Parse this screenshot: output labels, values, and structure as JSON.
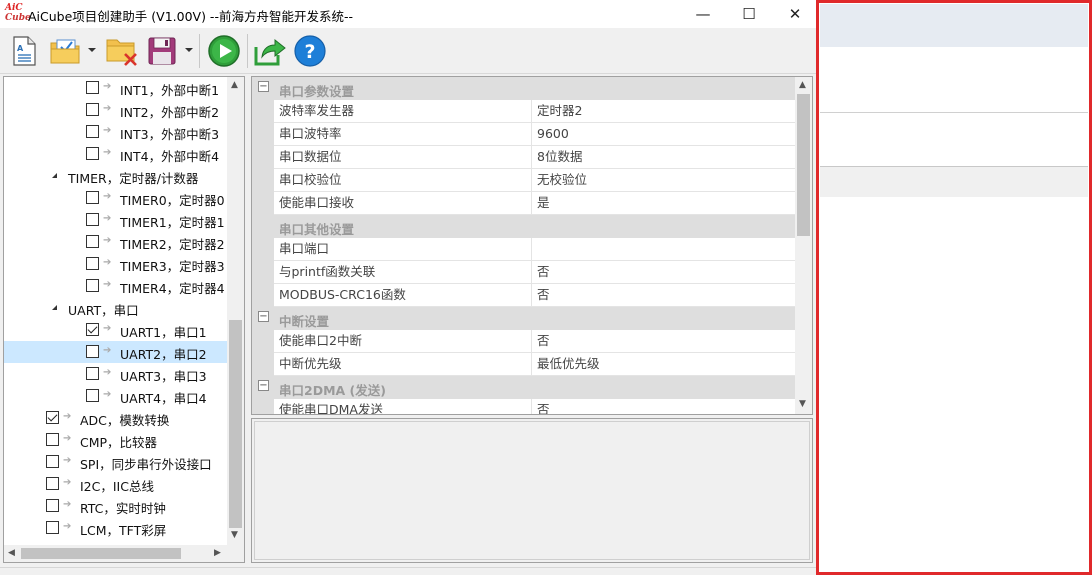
{
  "window": {
    "logo_line1": "AiC",
    "logo_line2": "Cube",
    "title": "AiCube项目创建助手 (V1.00V) --前海方舟智能开发系统--",
    "minimize": "—",
    "maximize": "☐",
    "close": "✕"
  },
  "toolbar": {
    "buttons": [
      {
        "name": "new-project",
        "icon": "new-document-icon"
      },
      {
        "name": "open-project",
        "icon": "open-folder-check-icon"
      },
      {
        "name": "close-project",
        "icon": "folder-delete-icon"
      },
      {
        "name": "save-project",
        "icon": "save-icon"
      },
      {
        "name": "run",
        "icon": "play-icon"
      },
      {
        "name": "export",
        "icon": "export-arrow-icon"
      },
      {
        "name": "help",
        "icon": "help-icon"
      }
    ],
    "help_glyph": "?"
  },
  "tree": {
    "items": [
      {
        "label": "INT1，外部中断1",
        "level": 2,
        "checked": false,
        "expander": false
      },
      {
        "label": "INT2，外部中断2",
        "level": 2,
        "checked": false,
        "expander": false
      },
      {
        "label": "INT3，外部中断3",
        "level": 2,
        "checked": false,
        "expander": false
      },
      {
        "label": "INT4，外部中断4",
        "level": 2,
        "checked": false,
        "expander": false
      },
      {
        "label": "TIMER，定时器/计数器",
        "level": 1,
        "checked": null,
        "expander": true
      },
      {
        "label": "TIMER0，定时器0",
        "level": 2,
        "checked": false,
        "expander": false
      },
      {
        "label": "TIMER1，定时器1",
        "level": 2,
        "checked": false,
        "expander": false
      },
      {
        "label": "TIMER2，定时器2",
        "level": 2,
        "checked": false,
        "expander": false
      },
      {
        "label": "TIMER3，定时器3",
        "level": 2,
        "checked": false,
        "expander": false
      },
      {
        "label": "TIMER4，定时器4",
        "level": 2,
        "checked": false,
        "expander": false
      },
      {
        "label": "UART，串口",
        "level": 1,
        "checked": null,
        "expander": true
      },
      {
        "label": "UART1，串口1",
        "level": 2,
        "checked": true,
        "expander": false
      },
      {
        "label": "UART2，串口2",
        "level": 2,
        "checked": false,
        "expander": false,
        "selected": true
      },
      {
        "label": "UART3，串口3",
        "level": 2,
        "checked": false,
        "expander": false
      },
      {
        "label": "UART4，串口4",
        "level": 2,
        "checked": false,
        "expander": false
      },
      {
        "label": "ADC，模数转换",
        "level": 0,
        "checked": true,
        "expander": false
      },
      {
        "label": "CMP，比较器",
        "level": 0,
        "checked": false,
        "expander": false
      },
      {
        "label": "SPI，同步串行外设接口",
        "level": 0,
        "checked": false,
        "expander": false
      },
      {
        "label": "I2C，IIC总线",
        "level": 0,
        "checked": false,
        "expander": false
      },
      {
        "label": "RTC，实时时钟",
        "level": 0,
        "checked": false,
        "expander": false
      },
      {
        "label": "LCM，TFT彩屏",
        "level": 0,
        "checked": false,
        "expander": false
      }
    ]
  },
  "properties": {
    "rows": [
      {
        "type": "category",
        "label": "串口参数设置"
      },
      {
        "type": "prop",
        "name": "波特率发生器",
        "value": "定时器2"
      },
      {
        "type": "prop",
        "name": "串口波特率",
        "value": "9600"
      },
      {
        "type": "prop",
        "name": "串口数据位",
        "value": "8位数据"
      },
      {
        "type": "prop",
        "name": "串口校验位",
        "value": "无校验位"
      },
      {
        "type": "prop",
        "name": "使能串口接收",
        "value": "是"
      },
      {
        "type": "category-nt",
        "label": "串口其他设置"
      },
      {
        "type": "prop",
        "name": "串口端口",
        "value": ""
      },
      {
        "type": "prop",
        "name": "与printf函数关联",
        "value": "否"
      },
      {
        "type": "prop",
        "name": "MODBUS-CRC16函数",
        "value": "否"
      },
      {
        "type": "category",
        "label": "中断设置"
      },
      {
        "type": "prop",
        "name": "使能串口2中断",
        "value": "否"
      },
      {
        "type": "prop",
        "name": "中断优先级",
        "value": "最低优先级"
      },
      {
        "type": "category",
        "label": "串口2DMA (发送)"
      },
      {
        "type": "prop",
        "name": "使能串口DMA发送",
        "value": "否"
      }
    ],
    "toggle_glyph": "−"
  },
  "colors": {
    "highlight_frame": "#e0292b",
    "tree_selection": "#cce8ff",
    "category_bg": "#dedede"
  }
}
